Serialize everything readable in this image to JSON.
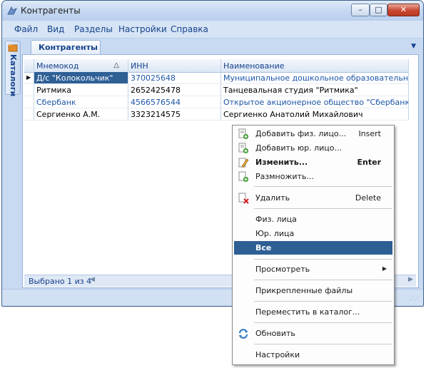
{
  "window": {
    "title": "Контрагенты",
    "controls": {
      "minimize": "–",
      "maximize": "□",
      "close": "✕"
    }
  },
  "menubar": [
    "Файл",
    "Вид",
    "Разделы",
    "Настройки",
    "Справка"
  ],
  "side_panel": {
    "label": "Каталоги"
  },
  "tab": {
    "label": "Контрагенты",
    "dropdown": "▼"
  },
  "grid": {
    "columns": [
      "Мнемокод",
      "ИНН",
      "Наименование"
    ],
    "sort_indicator": "△",
    "current_row_indicator": "▶",
    "rows": [
      {
        "mnemo": "Д/с \"Колокольчик\"",
        "inn": "370025648",
        "name": "Муниципальное дошкольное образовательное ..."
      },
      {
        "mnemo": "Ритмика",
        "inn": "2652425478",
        "name": "Танцевальная студия \"Ритмика\""
      },
      {
        "mnemo": "Сбербанк",
        "inn": "4566576544",
        "name": "Открытое акционерное общество \"Сбербанк Ро..."
      },
      {
        "mnemo": "Сергиенко А.М.",
        "inn": "3323214575",
        "name": "Сергиенко Анатолий Михайлович"
      }
    ]
  },
  "status": {
    "text": "Выбрано 1 из 4",
    "scroll_left": "◀",
    "scroll_right": "▶"
  },
  "context_menu": {
    "items": [
      {
        "label": "Добавить физ. лицо...",
        "shortcut": "Insert",
        "icon": "add-person-icon"
      },
      {
        "label": "Добавить юр. лицо...",
        "shortcut": "",
        "icon": "add-company-icon"
      },
      {
        "label": "Изменить...",
        "shortcut": "Enter",
        "icon": "edit-pencil-icon"
      },
      {
        "label": "Размножить...",
        "shortcut": "",
        "icon": "duplicate-icon"
      },
      {
        "label": "Удалить",
        "shortcut": "Delete",
        "icon": "delete-icon"
      },
      {
        "label": "Физ. лица",
        "shortcut": ""
      },
      {
        "label": "Юр. лица",
        "shortcut": ""
      },
      {
        "label": "Все",
        "shortcut": ""
      },
      {
        "label": "Просмотреть",
        "shortcut": "",
        "submenu_arrow": "▶"
      },
      {
        "label": "Прикрепленные файлы",
        "shortcut": ""
      },
      {
        "label": "Переместить в каталог...",
        "shortcut": ""
      },
      {
        "label": "Обновить",
        "shortcut": "",
        "icon": "refresh-icon"
      },
      {
        "label": "Настройки",
        "shortcut": ""
      }
    ]
  },
  "colors": {
    "selection": "#2e5f95",
    "menu_active": "#2d5f94",
    "link_text": "#1c56a8",
    "header_text": "#15428b"
  }
}
